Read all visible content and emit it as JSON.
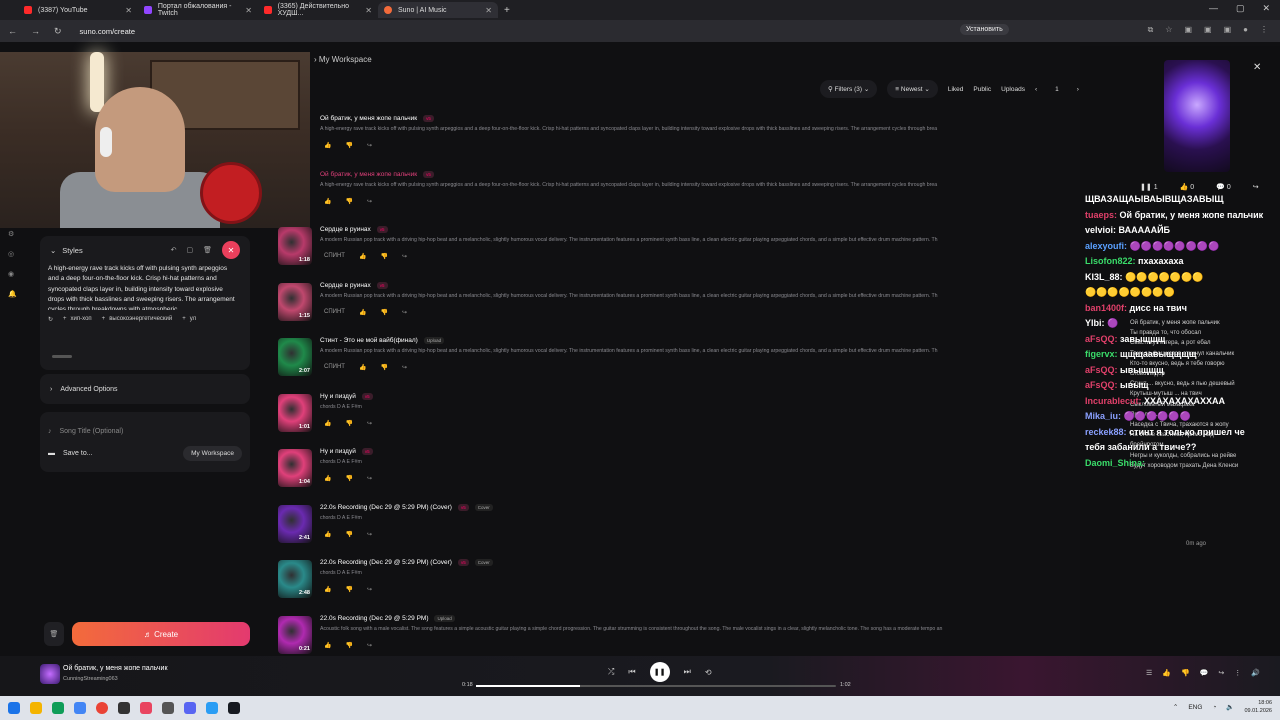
{
  "browser": {
    "tabs": [
      {
        "label": "(3387) YouTube",
        "color": "#ff2a2a"
      },
      {
        "label": "Портал обжалования - Twitch",
        "color": "#9146ff"
      },
      {
        "label": "(3365) Действительно ХУДШ...",
        "color": "#ff2a2a"
      },
      {
        "label": "Suno | AI Music",
        "color": "#f36b3b"
      }
    ],
    "url": "suno.com/create",
    "install_label": "Установить"
  },
  "breadcrumb": "My Workspace",
  "filters": {
    "filters_label": "Filters (3)",
    "sort_label": "Newest",
    "liked": "Liked",
    "public": "Public",
    "uploads": "Uploads",
    "page": "1"
  },
  "styles": {
    "label": "Styles",
    "text": "A high-energy rave track kicks off with pulsing synth arpeggios and a deep four-on-the-floor kick. Crisp hi-hat patterns and syncopated claps layer in, building intensity toward explosive drops with thick basslines and sweeping risers. The arrangement cycles through breakdowns with atmospheric",
    "chips": [
      "хип-хоп",
      "высокоэнергетический",
      "ул"
    ]
  },
  "advanced_options": "Advanced Options",
  "song_title_placeholder": "Song Title (Optional)",
  "save_to": "Save to...",
  "workspace_btn": "My Workspace",
  "create_label": "Create",
  "songs": [
    {
      "title": "Ой братик, у меня жопе пальчик",
      "version": "v5",
      "tag": "",
      "desc": "A high-energy rave track kicks off with pulsing synth arpeggios and a deep four-on-the-floor kick. Crisp hi-hat patterns and syncopated claps layer in, building intensity toward explosive drops with thick basslines and sweeping risers. The arrangement cycles through brea",
      "duration": "",
      "extra": "",
      "thumb": "#2a1a2a"
    },
    {
      "title": "Ой братик, у меня жопе пальчик",
      "version": "v5",
      "tag": "",
      "desc": "A high-energy rave track kicks off with pulsing synth arpeggios and a deep four-on-the-floor kick. Crisp hi-hat patterns and syncopated claps layer in, building intensity toward explosive drops with thick basslines and sweeping risers. The arrangement cycles through brea",
      "duration": "",
      "extra": "",
      "thumb": "#2a1a2a"
    },
    {
      "title": "Сердце в руинах",
      "version": "v5",
      "tag": "",
      "desc": "A modern Russian pop track with a driving hip-hop beat and a melancholic, slightly humorous vocal delivery. The instrumentation features a prominent synth bass line, a clean electric guitar playing arpeggiated chords, and a simple but effective drum machine pattern. Th",
      "duration": "1:18",
      "extra": "СПИНТ",
      "thumb": "#b83a6a"
    },
    {
      "title": "Сердце в руинах",
      "version": "v5",
      "tag": "",
      "desc": "A modern Russian pop track with a driving hip-hop beat and a melancholic, slightly humorous vocal delivery. The instrumentation features a prominent synth bass line, a clean electric guitar playing arpeggiated chords, and a simple but effective drum machine pattern. Th",
      "duration": "1:15",
      "extra": "СПИНТ",
      "thumb": "#c0486e"
    },
    {
      "title": "Стинт - Это не мой вайб(финал)",
      "version": "",
      "tag": "Upload",
      "desc": "A modern Russian pop track with a driving hip-hop beat and a melancholic, slightly humorous vocal delivery. The instrumentation features a prominent synth bass line, a clean electric guitar playing arpeggiated chords, and a simple but effective drum machine pattern. Th",
      "duration": "2:07",
      "extra": "СПИНТ",
      "thumb": "#1f8a4a"
    },
    {
      "title": "Ну и пиздуй",
      "version": "v5",
      "tag": "",
      "desc": "chords D A E F#m",
      "duration": "1:01",
      "extra": "",
      "thumb": "#e0407a"
    },
    {
      "title": "Ну и пиздуй",
      "version": "v5",
      "tag": "",
      "desc": "chords D A E F#m",
      "duration": "1:04",
      "extra": "",
      "thumb": "#e0407a"
    },
    {
      "title": "22.0s Recording (Dec 29 @ 5:29 PM) (Cover)",
      "version": "v5",
      "tag": "Cover",
      "desc": "chords D A E F#m",
      "duration": "2:41",
      "extra": "",
      "thumb": "#6a2ab0"
    },
    {
      "title": "22.0s Recording (Dec 29 @ 5:29 PM) (Cover)",
      "version": "v5",
      "tag": "Cover",
      "desc": "chords D A E F#m",
      "duration": "2:48",
      "extra": "",
      "thumb": "#2a8a8a"
    },
    {
      "title": "22.0s Recording (Dec 29 @ 5:29 PM)",
      "version": "",
      "tag": "Upload",
      "desc": "Acoustic folk song with a male vocalist. The song features a simple acoustic guitar playing a simple chord progression. The guitar strumming is consistent throughout the song. The male vocalist sings in a clear, slightly melancholic tone. The song has a moderate tempo an",
      "duration": "0:21",
      "extra": "",
      "thumb": "#b02ab0"
    }
  ],
  "now_playing_panel": {
    "likes": "0",
    "comments": "0",
    "plays": "1",
    "ago": "0m ago",
    "lyrics": [
      "Ой братик, у меня жопе пальчик",
      "Ты правда то, что обосал",
      "Свастику Гиггера, а рот ебал",
      "Твич за фашистов откинул канальчик",
      "Кто-то вкусно, ведь я тебе говорю",
      "слово пидор",
      "Стинт ... вкусно, ведь я пью дешевый",
      "Крутыш-мутыш ... на твич",
      "Сыкловатый мазафака",
      "Приплел ...",
      "Наседка с Твича, трахаются в жопу",
      "На стене свастика, прямо над",
      "брейнротом",
      "Негры и куколды, собрались на рейве",
      "Будут хороводом трахать Дена Кленси"
    ]
  },
  "chat": [
    {
      "name": "",
      "color": "#fff",
      "msg": "ЩВАЗАЩАЫВАЫВЩАЗАВЫЩ"
    },
    {
      "name": "tuaeps:",
      "color": "#e0406a",
      "msg": "Ой братик, у меня жопе пальчик"
    },
    {
      "name": "velvioi:",
      "color": "#fff",
      "msg": "ВАААААЙБ"
    },
    {
      "name": "alexyoufi:",
      "color": "#5aa0ff",
      "msg": "🟣🟣🟣🟣🟣🟣🟣🟣"
    },
    {
      "name": "Lisofon822:",
      "color": "#3adc6a",
      "msg": "пхахахаха"
    },
    {
      "name": "KI3L_88:",
      "color": "#fff",
      "msg": "🟡🟡🟡🟡🟡🟡🟡"
    },
    {
      "name": "",
      "color": "#fff",
      "msg": "🟡🟡🟡🟡🟡🟡🟡🟡"
    },
    {
      "name": "ban1400f:",
      "color": "#e0406a",
      "msg": "дисс на твич"
    },
    {
      "name": "Ylbi:",
      "color": "#fff",
      "msg": "🟣"
    },
    {
      "name": "aFsQQ:",
      "color": "#e0406a",
      "msg": "завыщщщ"
    },
    {
      "name": "figervx:",
      "color": "#3adc6a",
      "msg": "щщщаавыщщщщ"
    },
    {
      "name": "aFsQQ:",
      "color": "#e0406a",
      "msg": "ывыщщщ"
    },
    {
      "name": "aFsQQ:",
      "color": "#e0406a",
      "msg": "ывыщ"
    },
    {
      "name": "Incurablecut:",
      "color": "#e0406a",
      "msg": "ХХАХАХАХАХХАА"
    },
    {
      "name": "Mika_iu:",
      "color": "#8aa0ff",
      "msg": "🟣🟣🟣🟣🟣🟣"
    },
    {
      "name": "reckek88:",
      "color": "#8aa0ff",
      "msg": "стинт я только пришел че"
    },
    {
      "name": "",
      "color": "#fff",
      "msg": "тебя забанили а твиче??"
    },
    {
      "name": "Daomi_Shina:",
      "color": "#3adc6a",
      "msg": ""
    }
  ],
  "player": {
    "title": "Ой братик, у меня жопе пальчик",
    "artist": "CunningStreaming063",
    "time_current": "0:18",
    "time_total": "1:02",
    "progress": 0.29
  },
  "taskbar": {
    "lang": "ENG",
    "time": "18:06",
    "date": "09.01.2026"
  }
}
